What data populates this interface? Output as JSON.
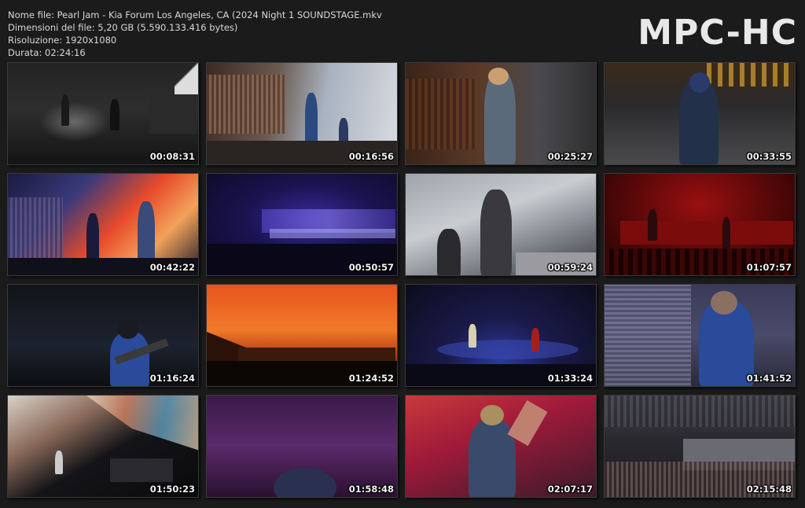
{
  "header": {
    "filename_line": "Nome file: Pearl Jam - Kia Forum Los Angeles, CA (2024 Night 1 SOUNDSTAGE.mkv",
    "filesize_line": "Dimensioni del file: 5,20 GB (5.590.133.416 bytes)",
    "resolution_line": "Risoluzione: 1920x1080",
    "duration_line": "Durata: 02:24:16",
    "brand": "MPC-HC"
  },
  "thumbnails": [
    {
      "timestamp": "00:08:31"
    },
    {
      "timestamp": "00:16:56"
    },
    {
      "timestamp": "00:25:27"
    },
    {
      "timestamp": "00:33:55"
    },
    {
      "timestamp": "00:42:22"
    },
    {
      "timestamp": "00:50:57"
    },
    {
      "timestamp": "00:59:24"
    },
    {
      "timestamp": "01:07:57"
    },
    {
      "timestamp": "01:16:24"
    },
    {
      "timestamp": "01:24:52"
    },
    {
      "timestamp": "01:33:24"
    },
    {
      "timestamp": "01:41:52"
    },
    {
      "timestamp": "01:50:23"
    },
    {
      "timestamp": "01:58:48"
    },
    {
      "timestamp": "02:07:17"
    },
    {
      "timestamp": "02:15:48"
    }
  ]
}
